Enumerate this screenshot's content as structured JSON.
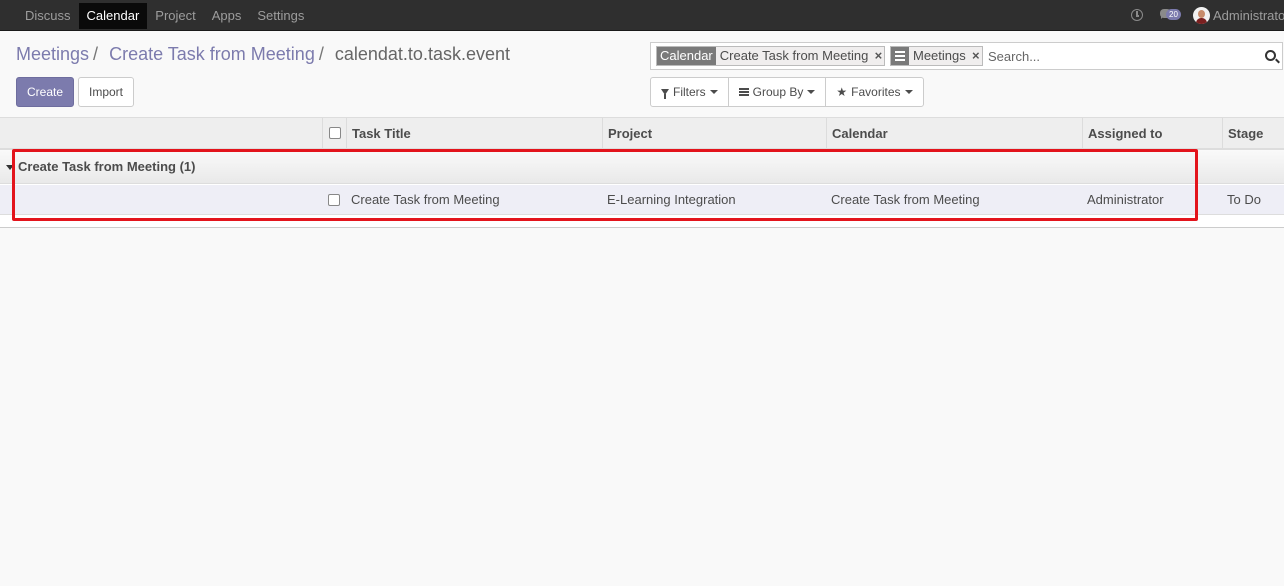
{
  "topbar": {
    "menu": [
      "Discuss",
      "Calendar",
      "Project",
      "Apps",
      "Settings"
    ],
    "active": "Calendar",
    "notification_count": "20",
    "username": "Administrator"
  },
  "breadcrumb": {
    "items": [
      "Meetings",
      "Create Task from Meeting"
    ],
    "current": "calendat.to.task.event"
  },
  "buttons": {
    "create": "Create",
    "import": "Import"
  },
  "search": {
    "facets": [
      {
        "label": "Calendar",
        "value": "Create Task from Meeting"
      },
      {
        "icon": "list-icon",
        "value": "Meetings"
      }
    ],
    "placeholder": "Search..."
  },
  "filters": {
    "filters": "Filters",
    "group_by": "Group By",
    "favorites": "Favorites"
  },
  "table": {
    "columns": [
      "Task Title",
      "Project",
      "Calendar",
      "Assigned to",
      "Stage"
    ],
    "group": {
      "label": "Create Task from Meeting (1)"
    },
    "rows": [
      {
        "task_title": "Create Task from Meeting",
        "project": "E-Learning Integration",
        "calendar": "Create Task from Meeting",
        "assigned_to": "Administrator",
        "stage": "To Do"
      }
    ]
  },
  "colors": {
    "accent": "#7c7bad",
    "navbar": "#2f2f2f",
    "highlight": "#e3141c"
  }
}
